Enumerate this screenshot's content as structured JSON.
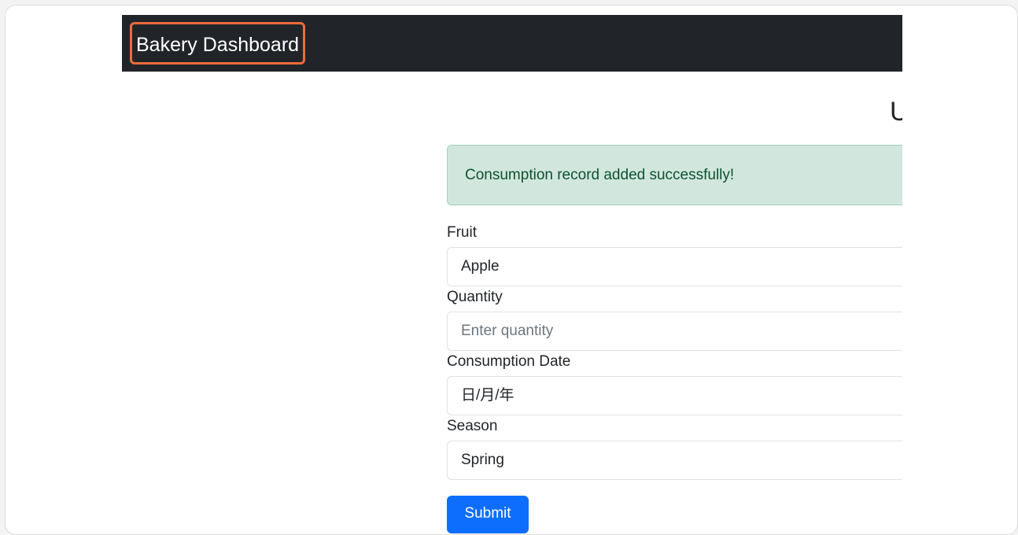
{
  "navbar": {
    "brand": "Bakery Dashboard"
  },
  "page": {
    "heading_fragment": "U"
  },
  "alert": {
    "message": "Consumption record added successfully!"
  },
  "form": {
    "fruit": {
      "label": "Fruit",
      "value": "Apple"
    },
    "quantity": {
      "label": "Quantity",
      "placeholder": "Enter quantity"
    },
    "consumption_date": {
      "label": "Consumption Date",
      "placeholder": "日/月/年"
    },
    "season": {
      "label": "Season",
      "value": "Spring"
    },
    "submit_label": "Submit"
  },
  "colors": {
    "navbar_bg": "#212529",
    "highlight_border": "#ee6a3c",
    "alert_bg": "#d1e7dd",
    "alert_text": "#0f5132",
    "primary": "#0d6efd"
  }
}
